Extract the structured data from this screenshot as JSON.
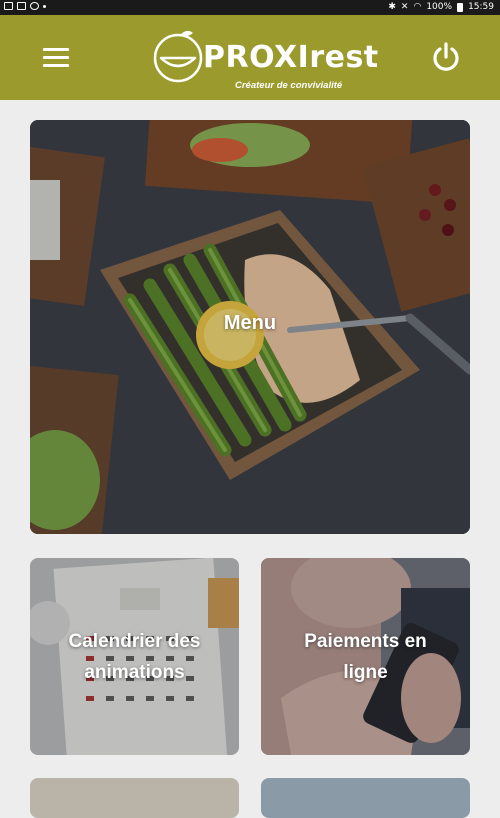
{
  "status_bar": {
    "battery": "100%",
    "time": "15:59"
  },
  "header": {
    "brand": "PROXIrest",
    "tagline": "Créateur de convivialité"
  },
  "tiles": [
    {
      "label": "Menu"
    },
    {
      "label": "Calendrier des animations"
    },
    {
      "label": "Paiements en ligne"
    }
  ],
  "colors": {
    "header_bg": "#9a9b2c",
    "text": "#ffffff",
    "background": "#ededed"
  },
  "icons": {
    "menu": "hamburger-icon",
    "power": "power-icon"
  }
}
